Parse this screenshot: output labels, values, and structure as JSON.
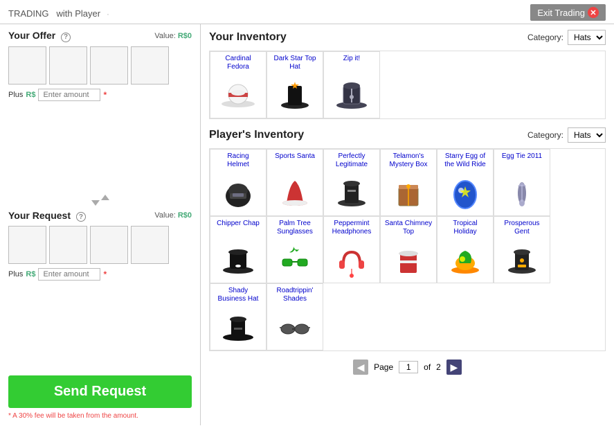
{
  "header": {
    "title": "TRADING",
    "subtitle": "with Player",
    "exit_label": "Exit Trading"
  },
  "left": {
    "offer": {
      "title": "Your Offer",
      "value_label": "Value:",
      "value": "R$0",
      "plus_label": "Plus R$",
      "amount_placeholder": "Enter amount"
    },
    "request": {
      "title": "Your Request",
      "value_label": "Value:",
      "value": "R$0",
      "plus_label": "Plus R$",
      "amount_placeholder": "Enter amount"
    },
    "send_label": "Send Request",
    "fee_note": "* A 30% fee will be taken from the amount."
  },
  "your_inventory": {
    "title": "Your Inventory",
    "category_label": "Category:",
    "category": "Hats",
    "items": [
      {
        "name": "Cardinal Fedora"
      },
      {
        "name": "Dark Star Top Hat"
      },
      {
        "name": "Zip it!"
      }
    ]
  },
  "player_inventory": {
    "title": "Player's Inventory",
    "category_label": "Category:",
    "category": "Hats",
    "items": [
      {
        "name": "Racing Helmet"
      },
      {
        "name": "Sports Santa"
      },
      {
        "name": "Perfectly Legitimate"
      },
      {
        "name": "Telamon's Mystery Box"
      },
      {
        "name": "Starry Egg of the Wild Ride"
      },
      {
        "name": "Egg Tie 2011"
      },
      {
        "name": "Chipper Chap"
      },
      {
        "name": "Palm Tree Sunglasses"
      },
      {
        "name": "Peppermint Headphones"
      },
      {
        "name": "Santa Chimney Top"
      },
      {
        "name": "Tropical Holiday"
      },
      {
        "name": "Prosperous Gent"
      },
      {
        "name": "Shady Business Hat"
      },
      {
        "name": "Roadtrippin' Shades"
      }
    ]
  },
  "pagination": {
    "page": "1",
    "total": "2",
    "prev_label": "◀",
    "next_label": "▶",
    "page_label": "Page",
    "of_label": "of"
  }
}
